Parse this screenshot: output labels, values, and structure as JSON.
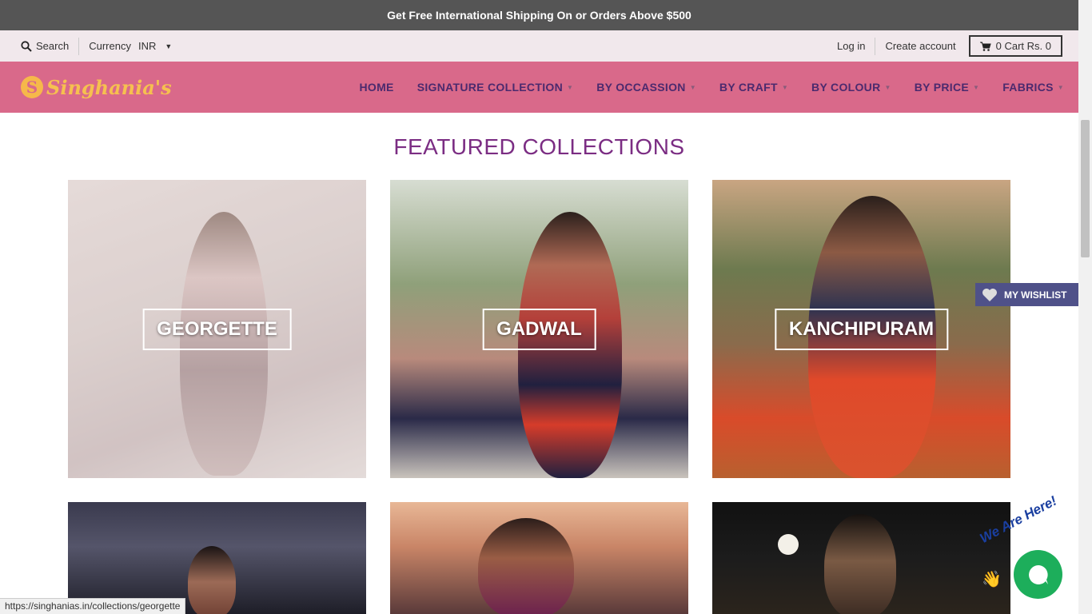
{
  "announcement": "Get Free International Shipping On or Orders Above $500",
  "utility": {
    "search_label": "Search",
    "currency_label": "Currency",
    "currency_value": "INR",
    "login": "Log in",
    "create_account": "Create account",
    "cart": "0 Cart Rs. 0"
  },
  "brand": {
    "letter": "S",
    "name": "Singhania's"
  },
  "menu": [
    {
      "label": "HOME",
      "dropdown": false
    },
    {
      "label": "SIGNATURE COLLECTION",
      "dropdown": true
    },
    {
      "label": "BY OCCASSION",
      "dropdown": true
    },
    {
      "label": "BY CRAFT",
      "dropdown": true
    },
    {
      "label": "BY COLOUR",
      "dropdown": true
    },
    {
      "label": "BY PRICE",
      "dropdown": true
    },
    {
      "label": "FABRICS",
      "dropdown": true
    }
  ],
  "featured": {
    "title": "FEATURED COLLECTIONS",
    "tiles": [
      "GEORGETTE",
      "GADWAL",
      "KANCHIPURAM"
    ]
  },
  "wishlist": "MY WISHLIST",
  "chat": {
    "tagline": "We Are Here!"
  },
  "status_url": "https://singhanias.in/collections/georgette",
  "colors": {
    "announcement_bg": "#555555",
    "utility_bg": "#f1e8ec",
    "nav_bg": "#d9698a",
    "nav_text": "#4b2a6e",
    "logo": "#f6c04f",
    "heading": "#7b2d83",
    "wishlist_bg": "#4f5189",
    "chat_bg": "#1dae5b"
  }
}
